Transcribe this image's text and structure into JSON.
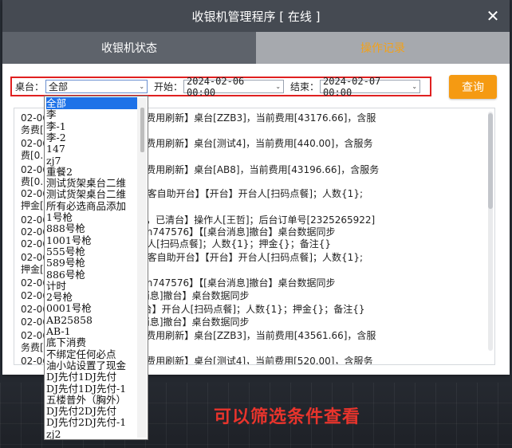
{
  "window": {
    "title": "收银机管理程序 [ 在线 ]",
    "close_glyph": "✕"
  },
  "tabs": [
    {
      "label": "收银机状态",
      "active": false
    },
    {
      "label": "操作记录",
      "active": true
    }
  ],
  "filters": {
    "table_label": "桌台：",
    "table_value": "全部",
    "start_label": "开始：",
    "start_value": "2024-02-06 00:00",
    "end_label": "结束：",
    "end_value": "2024-02-07 00:00"
  },
  "query_button": "查询",
  "dropdown_options": [
    "全部",
    "李",
    "李-1",
    "李-2",
    "147",
    "zj7",
    "重餐2",
    "测试货架桌台二维",
    "测试货架桌台二维",
    "所有必选商品添加",
    "1号枪",
    "888号枪",
    "1001号枪",
    "555号枪",
    "589号枪",
    "886号枪",
    "计时",
    "2号枪",
    "0001号枪",
    "AB25858",
    "AB-1",
    "底下消费",
    "不绑定任何必点",
    "油小站设置了现金",
    "DJ先付1DJ先付",
    "DJ先付1DJ先付-1",
    "五楼普外（胸外）",
    "DJ先付2DJ先付",
    "DJ先付2DJ先付-1",
    "zj2"
  ],
  "log_lines": [
    "02-06 【km747576】【时长费用刷新】桌台[ZZB3]，当前费用[43176.66]，含服",
    "务费[",
    "02-06 【km747576】【时长费用刷新】桌台[测试4]，当前费用[440.00]，含服务",
    "费[0.",
    "02-06 【km747576】【时长费用刷新】桌台[AB8]，当前费用[43196.66]，含服务",
    "费[0.0",
    "02-06 用桌台（固定码）】【顾客自助开台】【开台】开台人[扫码点餐]；人数{1};",
    "押金[",
    "02-06 km747576】【已取消，已清台】操作人[王哲]；后台订单号[2325265922]",
    "02-06 用桌台（固定码）】【km747576】【[桌台消息]撤台】桌台数据同步",
    "02-06 dj6993】【开台】开台人[扫码点餐]；人数{1}；押金{}；备注{}",
    "02-06 用桌台（固定码）】【顾客自助开台】【开台】开台人[扫码点餐]；人数{1};",
    "押金[",
    "02-06 用桌台（固定码）】【km747576】【[桌台消息]撤台】桌台数据同步",
    "02-06 km747576】【[桌台消息]撤台】桌台数据同步",
    "02-06 17771774323】【开台】开台人[扫码点餐]；人数{1}；押金{}；备注{}",
    "02-06 km747576】【[桌台消息]撤台】桌台数据同步",
    "02-06 【km747576】【时长费用刷新】桌台[ZZB3]，当前费用[43561.66]，含服",
    "务费[",
    "02-06 【km747576】【时长费用刷新】桌台[测试4]，当前费用[520.00]，含服务"
  ],
  "caption": "可以筛选条件查看",
  "colors": {
    "titlebar": "#454a52",
    "accent": "#f59a12",
    "highlight": "#e02020",
    "selected": "#1e72e8"
  }
}
